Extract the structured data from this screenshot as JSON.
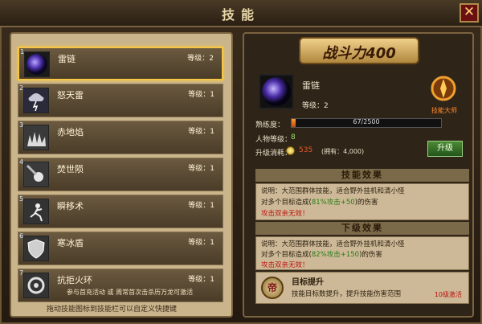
{
  "window": {
    "title": "技能",
    "close_label": "✕"
  },
  "skills": [
    {
      "num": "1",
      "name": "雷链",
      "level": "等级：2",
      "selected": true
    },
    {
      "num": "2",
      "name": "怒天雷",
      "level": "等级：1"
    },
    {
      "num": "3",
      "name": "赤地焰",
      "level": "等级：1"
    },
    {
      "num": "4",
      "name": "焚世陨",
      "level": "等级：1"
    },
    {
      "num": "5",
      "name": "瞬移术",
      "level": "等级：1"
    },
    {
      "num": "6",
      "name": "寒冰盾",
      "level": "等级：1"
    },
    {
      "num": "7",
      "name": "抗拒火环",
      "level": "等级：1",
      "desc": "参与首充活动 或 周常首次击杀历万龙可激活"
    }
  ],
  "left_footer": "拖动技能图标到技能栏可以自定义快捷键",
  "detail": {
    "power_label": "战斗力400",
    "name": "雷链",
    "level": "等级：2",
    "emblem_label": "技能大师",
    "xp_label": "熟练度：",
    "xp_text": "67/2500",
    "xp_fraction": 0.027,
    "condition_label": "人物等级：",
    "condition_value": "8",
    "cost_label": "升级消耗：",
    "cost_value": "535",
    "cost_owned": "(拥有：4,000)",
    "upgrade_button": "升级"
  },
  "effect_section": {
    "title": "技能效果",
    "line1": "说明：大范围群体技能，适合野外挂机和清小怪",
    "line2_prefix": "对多个目标造成(",
    "line2_value": "81%攻击+50",
    "line2_suffix": ")的伤害",
    "line3": "攻击双亲无效！"
  },
  "next_section": {
    "title": "下级效果",
    "line1": "说明：大范围群体技能，适合野外挂机和清小怪",
    "line2_prefix": "对多个目标造成(",
    "line2_value": "82%攻击+150",
    "line2_suffix": ")的伤害",
    "line3": "攻击双亲无效！"
  },
  "target": {
    "badge": "帝",
    "title": "目标提升",
    "desc": "技能目标数提升，提升技能伤害范围",
    "requirement": "10级激活"
  }
}
